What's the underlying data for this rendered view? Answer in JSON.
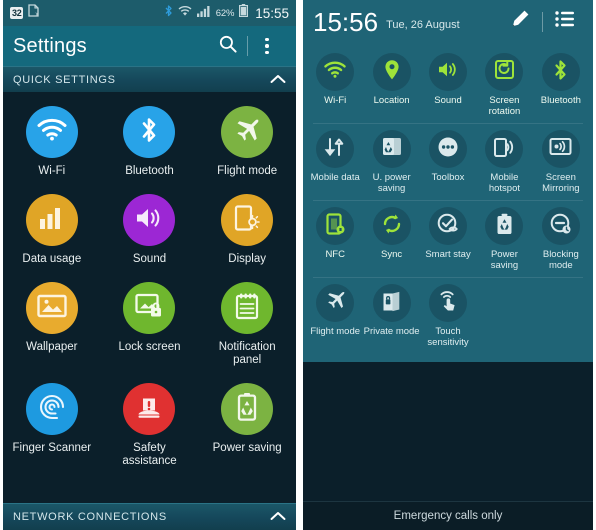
{
  "left_panel": {
    "status_bar": {
      "badge_text": "32",
      "doc_icon": "document-x-icon",
      "bluetooth_icon": "bluetooth-icon",
      "wifi_icon": "wifi-icon",
      "signal_icon": "signal-bars-icon",
      "battery_percent": "62%",
      "battery_icon": "battery-icon",
      "time": "15:55"
    },
    "action_bar": {
      "title": "Settings",
      "search_icon": "search-icon",
      "overflow_icon": "overflow-menu-icon"
    },
    "section_header": {
      "label": "QUICK SETTINGS",
      "collapse_icon": "chevron-up-icon"
    },
    "bottom_section": {
      "label": "NETWORK CONNECTIONS",
      "collapse_icon": "chevron-up-icon"
    },
    "tiles": [
      {
        "label": "Wi-Fi",
        "icon": "wifi-icon",
        "color": "#28a3e8"
      },
      {
        "label": "Bluetooth",
        "icon": "bluetooth-icon",
        "color": "#28a3e8"
      },
      {
        "label": "Flight mode",
        "icon": "airplane-icon",
        "color": "#7cb342"
      },
      {
        "label": "Data usage",
        "icon": "bar-chart-icon",
        "color": "#e0a526"
      },
      {
        "label": "Sound",
        "icon": "speaker-icon",
        "color": "#9c27d4"
      },
      {
        "label": "Display",
        "icon": "brightness-icon",
        "color": "#e0a526"
      },
      {
        "label": "Wallpaper",
        "icon": "picture-icon",
        "color": "#e8ab2e"
      },
      {
        "label": "Lock screen",
        "icon": "lock-screen-icon",
        "color": "#6fb72e"
      },
      {
        "label": "Notification panel",
        "icon": "notepad-icon",
        "color": "#6fb72e"
      },
      {
        "label": "Finger Scanner",
        "icon": "fingerprint-icon",
        "color": "#1e9ae0"
      },
      {
        "label": "Safety assistance",
        "icon": "alert-icon",
        "color": "#e03131"
      },
      {
        "label": "Power saving",
        "icon": "battery-recycle-icon",
        "color": "#7cb342"
      }
    ]
  },
  "right_panel": {
    "header": {
      "clock": "15:56",
      "date": "Tue, 26 August",
      "edit_icon": "pencil-icon",
      "list_icon": "list-icon"
    },
    "toggles": [
      {
        "label": "Wi-Fi",
        "icon": "wifi-icon",
        "active": true
      },
      {
        "label": "Location",
        "icon": "location-pin-icon",
        "active": true
      },
      {
        "label": "Sound",
        "icon": "speaker-icon",
        "active": true
      },
      {
        "label": "Screen rotation",
        "icon": "screen-rotate-icon",
        "active": true
      },
      {
        "label": "Bluetooth",
        "icon": "bluetooth-icon",
        "active": true
      },
      {
        "label": "Mobile data",
        "icon": "data-arrows-icon",
        "active": false
      },
      {
        "label": "U. power saving",
        "icon": "ultra-power-icon",
        "active": false
      },
      {
        "label": "Toolbox",
        "icon": "toolbox-dots-icon",
        "active": false
      },
      {
        "label": "Mobile hotspot",
        "icon": "hotspot-icon",
        "active": false
      },
      {
        "label": "Screen Mirroring",
        "icon": "screen-mirror-icon",
        "active": false
      },
      {
        "label": "NFC",
        "icon": "nfc-icon",
        "active": true
      },
      {
        "label": "Sync",
        "icon": "sync-icon",
        "active": true
      },
      {
        "label": "Smart stay",
        "icon": "smart-stay-icon",
        "active": false
      },
      {
        "label": "Power saving",
        "icon": "power-saving-icon",
        "active": false
      },
      {
        "label": "Blocking mode",
        "icon": "blocking-mode-icon",
        "active": false
      },
      {
        "label": "Flight mode",
        "icon": "airplane-icon",
        "active": false
      },
      {
        "label": "Private mode",
        "icon": "private-mode-icon",
        "active": false
      },
      {
        "label": "Touch sensitivity",
        "icon": "touch-icon",
        "active": false
      }
    ],
    "footer": {
      "label": "Emergency calls only"
    }
  },
  "colors": {
    "accent_teal": "#14697d",
    "panel_teal": "#1f6476",
    "dark_bg": "#0b1f2a",
    "active_green": "#9ee33a"
  }
}
